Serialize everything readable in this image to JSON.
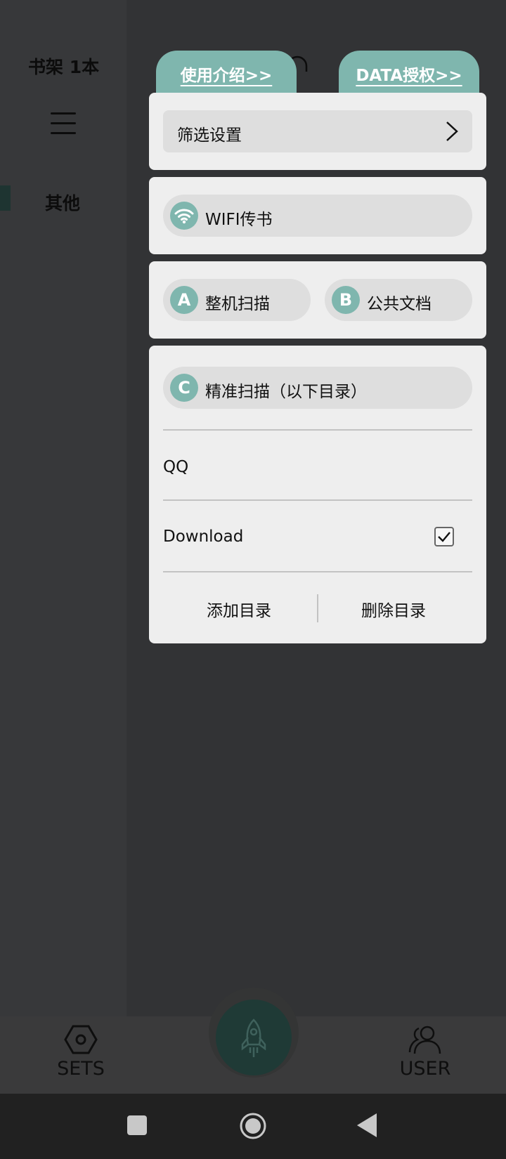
{
  "background": {
    "shelf_title": "书架 1本",
    "category_label": "其他"
  },
  "tabs": {
    "intro": "使用介绍>>",
    "data_auth": "DATA授权>>"
  },
  "popup": {
    "filter_settings": "筛选设置",
    "wifi_transfer": "WIFI传书",
    "full_scan": {
      "badge": "A",
      "label": "整机扫描"
    },
    "public_docs": {
      "badge": "B",
      "label": "公共文档"
    },
    "precise_scan": {
      "badge": "C",
      "label": "精准扫描（以下目录）"
    },
    "directories": [
      {
        "name": "QQ",
        "checked": false
      },
      {
        "name": "Download",
        "checked": true
      }
    ],
    "add_dir": "添加目录",
    "delete_dir": "删除目录"
  },
  "bottom_nav": {
    "sets": "SETS",
    "user": "USER"
  },
  "colors": {
    "accent": "#7fb6ae",
    "card": "#eeeeee",
    "pill": "#dedede"
  }
}
